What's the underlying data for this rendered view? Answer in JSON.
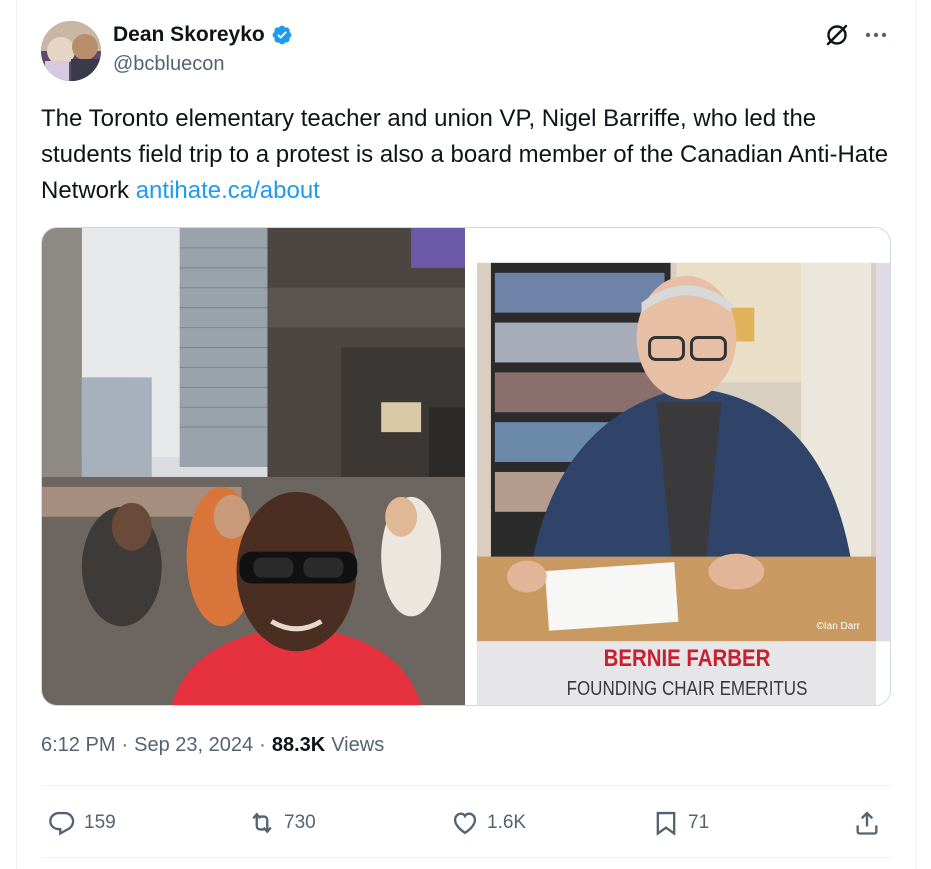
{
  "author": {
    "display_name": "Dean Skoreyko",
    "handle": "@bcbluecon",
    "verified": true
  },
  "tweet": {
    "text": "The Toronto elementary teacher and union VP, Nigel Barriffe, who led the students field trip to a protest is also a board member of the Canadian Anti-Hate Network",
    "link_text": "antihate.ca/about"
  },
  "media": {
    "right_image": {
      "caption_name": "BERNIE FARBER",
      "caption_title": "FOUNDING CHAIR EMERITUS",
      "credit": "©Ian Darr"
    }
  },
  "meta": {
    "time": "6:12 PM",
    "separator": "·",
    "date": "Sep 23, 2024",
    "views_count": "88.3K",
    "views_label": "Views"
  },
  "actions": {
    "replies": "159",
    "reposts": "730",
    "likes": "1.6K",
    "bookmarks": "71"
  },
  "colors": {
    "accent": "#1d9bf0",
    "text": "#0f1419",
    "secondary": "#536471",
    "caption_red": "#c8202e"
  },
  "icons": {
    "verified": "verified-badge-icon",
    "grok": "grok-icon",
    "more": "more-icon",
    "reply": "reply-icon",
    "repost": "repost-icon",
    "like": "heart-icon",
    "bookmark": "bookmark-icon",
    "share": "share-icon"
  }
}
